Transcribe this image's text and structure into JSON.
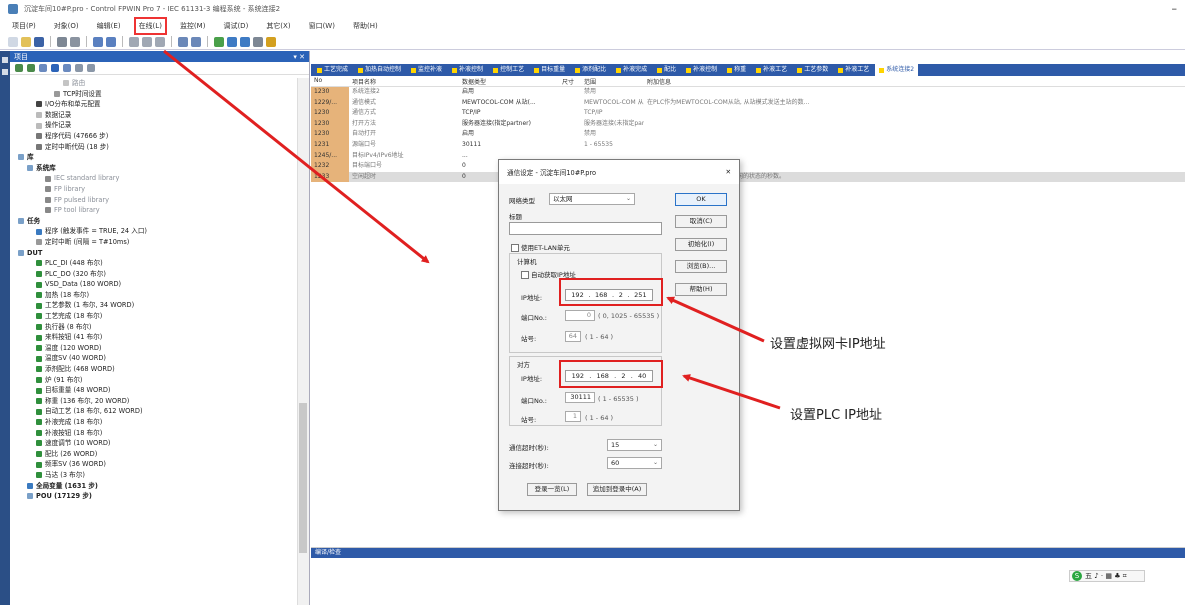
{
  "window": {
    "title": "沉淀车间10#P.pro - Control FPWIN Pro 7 - IEC 61131-3 编程系统 - 系统连接2",
    "minimize": "–"
  },
  "menubar": [
    "项目(P)",
    "对象(O)",
    "编辑(E)",
    "在线(L)",
    "监控(M)",
    "调试(D)",
    "其它(X)",
    "窗口(W)",
    "帮助(H)"
  ],
  "left_panel": {
    "header": "项目",
    "close_label": "▾ ✕",
    "tree": [
      {
        "label": "路由",
        "indent": 5,
        "style": "gray",
        "icon": "folder-icon",
        "color": "#c4c4c4"
      },
      {
        "label": "TCP时间设置",
        "indent": 4,
        "style": "normal",
        "icon": "clock-icon",
        "color": "#999999"
      },
      {
        "label": "I/O分布和单元配置",
        "indent": 2,
        "style": "normal",
        "icon": "module-icon",
        "color": "#444444"
      },
      {
        "label": "数据记录",
        "indent": 2,
        "style": "normal",
        "icon": "record-icon",
        "color": "#bbbbbb"
      },
      {
        "label": "操作记录",
        "indent": 2,
        "style": "normal",
        "icon": "record-icon",
        "color": "#bbbbbb"
      },
      {
        "label": "程序代码 (47666 步)",
        "indent": 2,
        "style": "normal",
        "icon": "code-icon",
        "color": "#777777"
      },
      {
        "label": "定时中断代码 (18 步)",
        "indent": 2,
        "style": "normal",
        "icon": "code-icon",
        "color": "#777777"
      },
      {
        "label": "库",
        "indent": 0,
        "style": "bold",
        "icon": "library-icon",
        "color": "#7aa0c8"
      },
      {
        "label": "系统库",
        "indent": 1,
        "style": "bold",
        "icon": "library-icon",
        "color": "#7aa0c8"
      },
      {
        "label": "IEC standard library",
        "indent": 3,
        "style": "gray",
        "icon": "book-icon",
        "color": "#888888"
      },
      {
        "label": "FP library",
        "indent": 3,
        "style": "gray",
        "icon": "book-icon",
        "color": "#888888"
      },
      {
        "label": "FP pulsed library",
        "indent": 3,
        "style": "gray",
        "icon": "book-icon",
        "color": "#888888"
      },
      {
        "label": "FP tool library",
        "indent": 3,
        "style": "gray",
        "icon": "book-icon",
        "color": "#888888"
      },
      {
        "label": "任务",
        "indent": 0,
        "style": "bold",
        "icon": "task-icon",
        "color": "#7aa0c8"
      },
      {
        "label": "程序 (触发事件 = TRUE, 24 入口)",
        "indent": 2,
        "style": "normal",
        "icon": "program-icon",
        "color": "#3a7ac0"
      },
      {
        "label": "定时中断 (间隔 = T#10ms)",
        "indent": 2,
        "style": "normal",
        "icon": "timer-icon",
        "color": "#999999"
      },
      {
        "label": "DUT",
        "indent": 0,
        "style": "bold",
        "icon": "dut-icon",
        "color": "#7aa0c8"
      },
      {
        "label": "PLC_DI (448 布尔)",
        "indent": 2,
        "style": "normal",
        "icon": "struct-icon",
        "color": "#2f8f3c"
      },
      {
        "label": "PLC_DO (320 布尔)",
        "indent": 2,
        "style": "normal",
        "icon": "struct-icon",
        "color": "#2f8f3c"
      },
      {
        "label": "VSD_Data (180 WORD)",
        "indent": 2,
        "style": "normal",
        "icon": "struct-icon",
        "color": "#2f8f3c"
      },
      {
        "label": "加热 (18 布尔)",
        "indent": 2,
        "style": "normal",
        "icon": "struct-icon",
        "color": "#2f8f3c"
      },
      {
        "label": "工艺参数 (1 布尔, 34 WORD)",
        "indent": 2,
        "style": "normal",
        "icon": "struct-icon",
        "color": "#2f8f3c"
      },
      {
        "label": "工艺完成 (18 布尔)",
        "indent": 2,
        "style": "normal",
        "icon": "struct-icon",
        "color": "#2f8f3c"
      },
      {
        "label": "执行器 (8 布尔)",
        "indent": 2,
        "style": "normal",
        "icon": "struct-icon",
        "color": "#2f8f3c"
      },
      {
        "label": "来料按钮 (41 布尔)",
        "indent": 2,
        "style": "normal",
        "icon": "struct-icon",
        "color": "#2f8f3c"
      },
      {
        "label": "温度 (120 WORD)",
        "indent": 2,
        "style": "normal",
        "icon": "struct-icon",
        "color": "#2f8f3c"
      },
      {
        "label": "温度SV (40 WORD)",
        "indent": 2,
        "style": "normal",
        "icon": "struct-icon",
        "color": "#2f8f3c"
      },
      {
        "label": "添剂配比 (468 WORD)",
        "indent": 2,
        "style": "normal",
        "icon": "struct-icon",
        "color": "#2f8f3c"
      },
      {
        "label": "炉 (91 布尔)",
        "indent": 2,
        "style": "normal",
        "icon": "struct-icon",
        "color": "#2f8f3c"
      },
      {
        "label": "目标重量 (48 WORD)",
        "indent": 2,
        "style": "normal",
        "icon": "struct-icon",
        "color": "#2f8f3c"
      },
      {
        "label": "称重 (136 布尔, 20 WORD)",
        "indent": 2,
        "style": "normal",
        "icon": "struct-icon",
        "color": "#2f8f3c"
      },
      {
        "label": "自动工艺 (18 布尔, 612 WORD)",
        "indent": 2,
        "style": "normal",
        "icon": "struct-icon",
        "color": "#2f8f3c"
      },
      {
        "label": "补液完成 (18 布尔)",
        "indent": 2,
        "style": "normal",
        "icon": "struct-icon",
        "color": "#2f8f3c"
      },
      {
        "label": "补液按钮 (18 布尔)",
        "indent": 2,
        "style": "normal",
        "icon": "struct-icon",
        "color": "#2f8f3c"
      },
      {
        "label": "速度调节 (10 WORD)",
        "indent": 2,
        "style": "normal",
        "icon": "struct-icon",
        "color": "#2f8f3c"
      },
      {
        "label": "配比 (26 WORD)",
        "indent": 2,
        "style": "normal",
        "icon": "struct-icon",
        "color": "#2f8f3c"
      },
      {
        "label": "频率SV (36 WORD)",
        "indent": 2,
        "style": "normal",
        "icon": "struct-icon",
        "color": "#2f8f3c"
      },
      {
        "label": "马达 (3 布尔)",
        "indent": 2,
        "style": "normal",
        "icon": "struct-icon",
        "color": "#2f8f3c"
      },
      {
        "label": "全局变量 (1631 步)",
        "indent": 1,
        "style": "bold",
        "icon": "global-icon",
        "color": "#3a7ac0"
      },
      {
        "label": "POU (17129 步)",
        "indent": 1,
        "style": "bold",
        "icon": "pou-icon",
        "color": "#7aa0c8"
      }
    ]
  },
  "tabs": [
    "工艺完成",
    "加热自动控制",
    "监控补液",
    "补液控制",
    "控制工艺",
    "目标重量",
    "添剂配比",
    "补液完成",
    "配比",
    "补液控制",
    "称重",
    "补液工艺",
    "工艺参数",
    "补液工艺",
    "系统连接2"
  ],
  "grid": {
    "headers": [
      "No",
      "项目名称",
      "数据类型",
      "尺寸",
      "范围",
      "附加信息"
    ],
    "rows": [
      {
        "no": "1230",
        "name": "系统连接2",
        "type": "启用",
        "size": "",
        "range": "禁用",
        "info": ""
      },
      {
        "no": "1229/...",
        "name": "通信模式",
        "type": "MEWTOCOL-COM 从站(...",
        "size": "",
        "range": "MEWTOCOL-COM 从站(...",
        "info": "在PLC作为MEWTOCOL-COM从站, 从站模式发送主站的数..."
      },
      {
        "no": "1230",
        "name": "通信方式",
        "type": "TCP/IP",
        "size": "",
        "range": "TCP/IP",
        "info": ""
      },
      {
        "no": "1230",
        "name": "打开方法",
        "type": "服务器连接(指定partner)",
        "size": "",
        "range": "服务器连接(未指定partner)",
        "info": ""
      },
      {
        "no": "1230",
        "name": "自动打开",
        "type": "启用",
        "size": "",
        "range": "禁用",
        "info": ""
      },
      {
        "no": "1231",
        "name": "源端口号",
        "type": "30111",
        "size": "",
        "range": "1 - 65535",
        "info": ""
      },
      {
        "no": "1245/...",
        "name": "目标IPv4/IPv6地址",
        "type": "...",
        "size": "",
        "range": "",
        "info": ""
      },
      {
        "no": "1232",
        "name": "目标端口号",
        "type": "0",
        "size": "",
        "range": "",
        "info": ""
      },
      {
        "no": "1233",
        "name": "空闲超时",
        "type": "0",
        "size": "",
        "range": "",
        "info": "指定一个链接在断开前可能保持空闲的状态的秒数。"
      }
    ]
  },
  "bottom_panel": {
    "header": "编译/检查",
    "ime_text": "五 ♪ · ▦ ♣ ⌗"
  },
  "dialog": {
    "title": "通信设定 - 沉淀车间10#P.pro",
    "close": "✕",
    "network_type_label": "网络类型",
    "network_type_value": "以太网",
    "tag_label": "标题",
    "tag_value": "",
    "use_etlan_label": "使用ET-LAN单元",
    "computer_group": "计算机",
    "auto_ip_label": "自动获取IP地址",
    "ip_label": "IP地址:",
    "pc_ip": [
      "192",
      "168",
      "2",
      "251"
    ],
    "port_label": "端口No.:",
    "pc_port": "0",
    "pc_port_range": "( 0, 1025 - 65535 )",
    "station_label": "站号:",
    "pc_station": "64",
    "pc_station_range": "( 1 - 64 )",
    "partner_group": "对方",
    "plc_ip": [
      "192",
      "168",
      "2",
      "40"
    ],
    "plc_port": "30111",
    "plc_port_range": "( 1 - 65535 )",
    "plc_station": "1",
    "plc_station_range": "( 1 - 64 )",
    "comm_timeout_label": "通信超时(秒):",
    "comm_timeout_value": "15",
    "conn_timeout_label": "连接超时(秒):",
    "conn_timeout_value": "60",
    "buttons": {
      "ok": "OK",
      "cancel": "取消(C)",
      "initialize": "初始化(I)",
      "browse": "浏览(B)...",
      "help": "帮助(H)",
      "login_list": "登录一览(L)",
      "add_login": "追加到登录中(A)"
    }
  },
  "annotations": {
    "virtual_nic": "设置虚拟网卡IP地址",
    "plc_ip": "设置PLC IP地址",
    "arrow_color": "#e02020"
  }
}
